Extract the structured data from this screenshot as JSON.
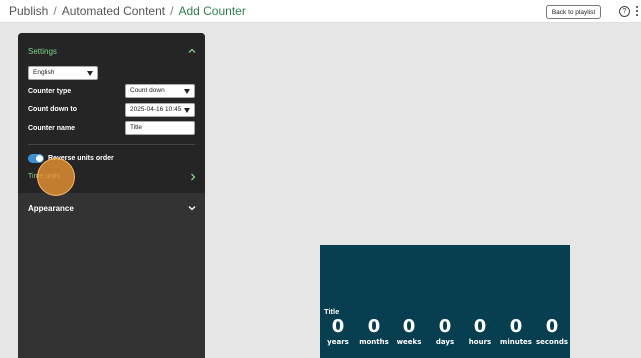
{
  "breadcrumb": [
    "Publish",
    "Automated Content",
    "Add Counter"
  ],
  "breadcrumb_separator": "/",
  "header": {
    "back_button_label": "Back to playlist",
    "help_icon": "help-circle-icon",
    "more_icon": "vertical-dots-icon"
  },
  "settings": {
    "title": "Settings",
    "language": "English",
    "counter_type_label": "Counter type",
    "counter_type_value": "Count down",
    "count_down_to_label": "Count down to",
    "count_down_to_value": "2025-04-16 10:45",
    "counter_name_label": "Counter name",
    "counter_name_value": "Title",
    "reverse_units_label": "Reverse units order",
    "reverse_units_on": true,
    "time_units_label": "Time units"
  },
  "appearance": {
    "title": "Appearance"
  },
  "preview": {
    "title": "Title",
    "units": [
      {
        "value": "0",
        "label": "years"
      },
      {
        "value": "0",
        "label": "months"
      },
      {
        "value": "0",
        "label": "weeks"
      },
      {
        "value": "0",
        "label": "days"
      },
      {
        "value": "0",
        "label": "hours"
      },
      {
        "value": "0",
        "label": "minutes"
      },
      {
        "value": "0",
        "label": "seconds"
      }
    ]
  },
  "colors": {
    "accent_green": "#7fd18a",
    "breadcrumb_current": "#2e7d4f",
    "preview_bg": "#073e50",
    "toggle_on": "#3d8fd6",
    "cursor_highlight": "#f09632"
  }
}
